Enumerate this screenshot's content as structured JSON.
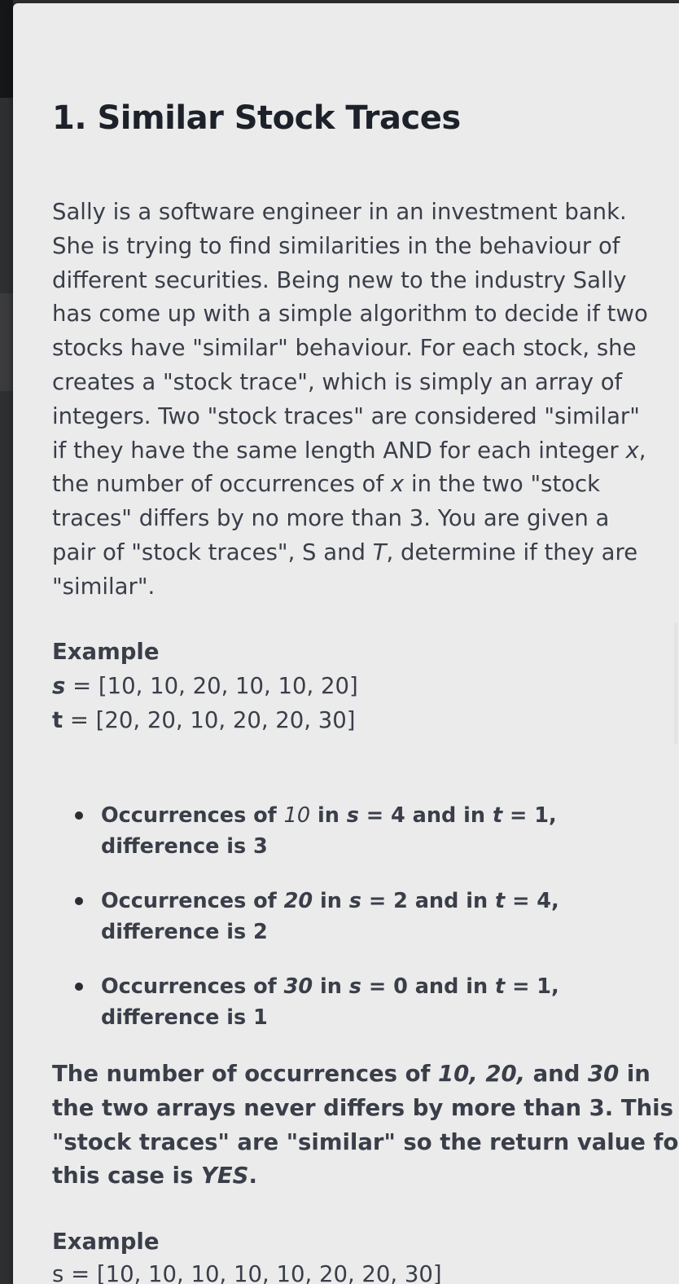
{
  "problem": {
    "title": "1. Similar Stock Traces",
    "description_lines": [
      "Sally is a software engineer in an investment bank.",
      "She is trying to find similarities in the behaviour of",
      "different securities. Being new to the industry Sally",
      "has come up with a simple algorithm to decide if two",
      "stocks have \"similar\" behaviour. For each stock, she",
      "creates a \"stock trace\", which is simply an array of",
      "integers. Two \"stock traces\" are considered \"similar\"",
      "if they have the same length AND for each integer ",
      "the number of occurrences of ",
      "traces\" differs by no more than 3. You are given a",
      "pair of \"stock traces\", S and ",
      "\"similar\"."
    ],
    "desc_var_x": "x",
    "desc_line8_end": ",",
    "desc_line9_end": " in the two \"stock",
    "desc_var_T": "T",
    "desc_line11_end": ", determine if they are"
  },
  "example1": {
    "heading": "Example",
    "s_name": "s",
    "s_value": " = [10, 10, 20, 10, 10, 20]",
    "t_name": "t",
    "t_value": " = [20, 20, 10, 20, 20, 30]",
    "bullets": [
      {
        "a": "Occurrences of ",
        "num": "10",
        "b": " in ",
        "s": "s",
        "c": " = 4 and in ",
        "t": "t",
        "d": " = 1,",
        "line2": "difference is 3"
      },
      {
        "a": "Occurrences of ",
        "num": "20",
        "b": " in ",
        "s": "s",
        "c": " = 2 and in ",
        "t": "t",
        "d": " = 4,",
        "line2": "difference is 2"
      },
      {
        "a": "Occurrences of ",
        "num": "30",
        "b": " in ",
        "s": "s",
        "c": " = 0 and in ",
        "t": "t",
        "d": " = 1,",
        "line2": "difference is 1"
      }
    ],
    "summary": {
      "l1a": "The number of occurrences of ",
      "l1n": "10, 20,",
      "l1b": " and ",
      "l1c": "30",
      "l1d": " in",
      "l2": "the two arrays never differs by more than 3. This",
      "l3": "\"stock traces\" are \"similar\" so the return value for",
      "l4a": "this case is ",
      "l4b": "YES",
      "l4c": "."
    }
  },
  "example2": {
    "heading": "Example",
    "s_partial": "s = [10, 10, 10, 10, 10, 20, 20, 30]"
  }
}
